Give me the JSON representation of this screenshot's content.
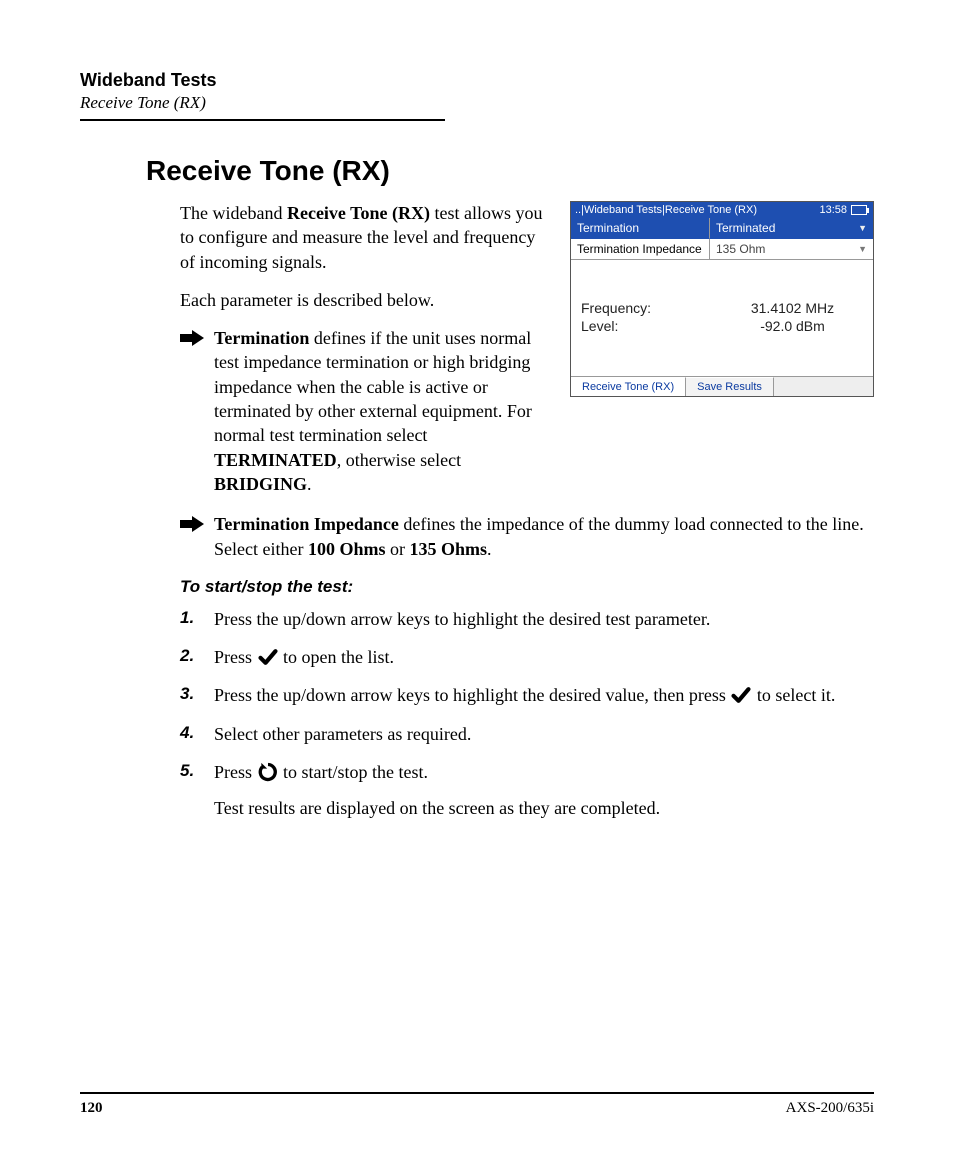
{
  "header": {
    "section": "Wideband Tests",
    "subsection": "Receive Tone (RX)"
  },
  "title": "Receive Tone (RX)",
  "intro": {
    "p1_pre": "The wideband ",
    "p1_bold": "Receive Tone (RX)",
    "p1_post": " test allows you to configure and measure the level and frequency of incoming signals.",
    "p2": "Each parameter is described below."
  },
  "device": {
    "breadcrumb": "..|Wideband Tests|Receive Tone (RX)",
    "time": "13:58",
    "rows": [
      {
        "label": "Termination",
        "value": "Terminated",
        "highlight": true
      },
      {
        "label": "Termination Impedance",
        "value": "135 Ohm",
        "highlight": false
      }
    ],
    "readouts": {
      "freq_label": "Frequency:",
      "freq_value": "31.4102 MHz",
      "level_label": "Level:",
      "level_value": "-92.0 dBm"
    },
    "tabs": {
      "active": "Receive Tone (RX)",
      "secondary": "Save Results"
    }
  },
  "bullets": {
    "b1": {
      "bold": "Termination",
      "text_a": " defines if the unit uses normal test impedance termination or high bridging impedance when the cable is active or terminated by other external equipment. For normal test termination select ",
      "opt1": "TERMINATED",
      "mid": ", otherwise select ",
      "opt2": "BRIDGING",
      "end": "."
    },
    "b2": {
      "bold": "Termination Impedance",
      "text_a": " defines the impedance of the dummy load connected to the line. Select either ",
      "opt1": "100 Ohms",
      "mid": " or ",
      "opt2": "135 Ohms",
      "end": "."
    }
  },
  "procedure_heading": "To start/stop the test:",
  "steps": {
    "s1": "Press the up/down arrow keys to highlight the desired test parameter.",
    "s2_pre": "Press ",
    "s2_post": " to open the list.",
    "s3_pre": "Press the up/down arrow keys to highlight the desired value, then press ",
    "s3_post": " to select it.",
    "s4": "Select other parameters as required.",
    "s5_pre": "Press ",
    "s5_post": " to start/stop the test.",
    "s5_note": "Test results are displayed on the screen as they are completed."
  },
  "footer": {
    "page": "120",
    "doc": "AXS-200/635i"
  }
}
